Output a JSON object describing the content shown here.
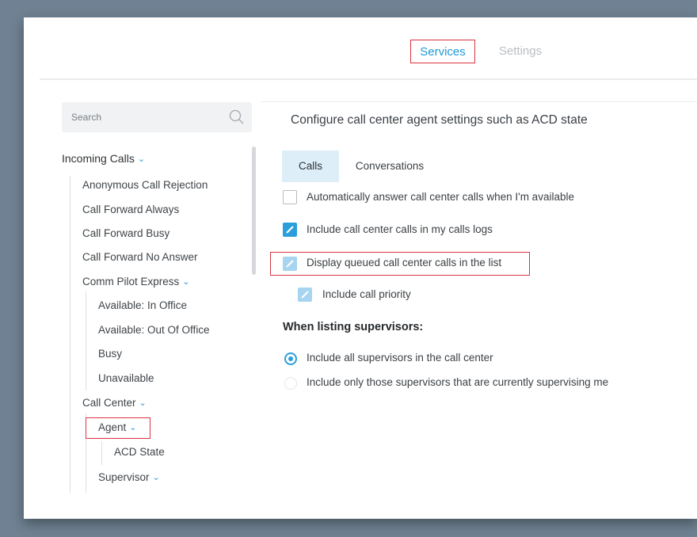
{
  "topnav": {
    "tabs": [
      {
        "label": "Services",
        "active": true
      },
      {
        "label": "Settings",
        "active": false
      }
    ]
  },
  "sidebar": {
    "search_placeholder": "Search",
    "tree": {
      "incoming_calls": "Incoming Calls",
      "anonymous_call_rejection": "Anonymous Call Rejection",
      "call_forward_always": "Call Forward Always",
      "call_forward_busy": "Call Forward Busy",
      "call_forward_no_answer": "Call Forward No Answer",
      "comm_pilot_express": "Comm Pilot Express",
      "available_in_office": "Available: In Office",
      "available_out_of_office": "Available: Out Of Office",
      "busy": "Busy",
      "unavailable": "Unavailable",
      "call_center": "Call Center",
      "agent": "Agent",
      "acd_state": "ACD State",
      "supervisor": "Supervisor"
    }
  },
  "content": {
    "title": "Configure call center agent settings such as ACD state",
    "tabs": [
      "Calls",
      "Conversations"
    ],
    "options": [
      {
        "label": "Automatically answer call center calls when I'm available",
        "checked": false
      },
      {
        "label": "Include call center calls in my calls logs",
        "checked": true
      },
      {
        "label": "Display queued call center calls in the list",
        "checked": true
      },
      {
        "label": "Include call priority",
        "checked": true
      }
    ],
    "supervisors_heading": "When listing supervisors:",
    "radios": [
      {
        "label": "Include all supervisors in the call center",
        "selected": true
      },
      {
        "label": "Include only those supervisors that are currently supervising me",
        "selected": false
      }
    ]
  },
  "colors": {
    "accent": "#2c9fdb",
    "highlight_box": "#d9333f",
    "background": "#6f8192"
  },
  "icons": [
    "search-icon",
    "chevron-down-icon",
    "checkmark-icon"
  ]
}
